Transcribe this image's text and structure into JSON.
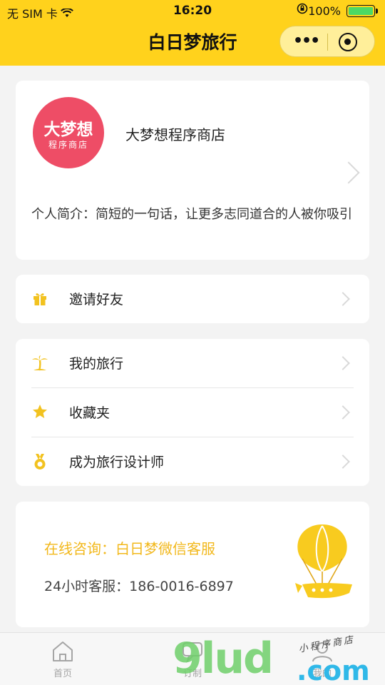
{
  "status_bar": {
    "carrier": "无 SIM 卡",
    "time": "16:20",
    "battery": "100%",
    "battery_level": 1.0
  },
  "nav": {
    "title": "白日梦旅行",
    "more_icon": "more-dots-icon",
    "close_icon": "target-icon"
  },
  "profile": {
    "avatar_big": "大梦想",
    "avatar_small": "程序商店",
    "avatar_color": "#ee4d66",
    "name": "大梦想程序商店",
    "intro": "个人简介：简短的一句话，让更多志同道合的人被你吸引"
  },
  "invite": {
    "label": "邀请好友",
    "icon": "gift-icon"
  },
  "menu": [
    {
      "label": "我的旅行",
      "icon": "palm-tree-icon"
    },
    {
      "label": "收藏夹",
      "icon": "star-icon"
    },
    {
      "label": "成为旅行设计师",
      "icon": "medal-icon"
    }
  ],
  "contact": {
    "online": "在线咨询：白日梦微信客服",
    "hotline": "24小时客服：186-0016-6897",
    "icon": "hot-air-balloon-icon"
  },
  "tabs": [
    {
      "label": "首页",
      "icon": "home-icon"
    },
    {
      "label": "订制",
      "icon": "chat-icon"
    },
    {
      "label": "我的",
      "icon": "user-icon"
    }
  ],
  "watermark": {
    "main": "9lud",
    "domain": ".com",
    "sub": "小程序商店"
  },
  "colors": {
    "accent": "#ffd21c",
    "icon": "#f2c21f",
    "contact_text": "#f2b81c"
  }
}
